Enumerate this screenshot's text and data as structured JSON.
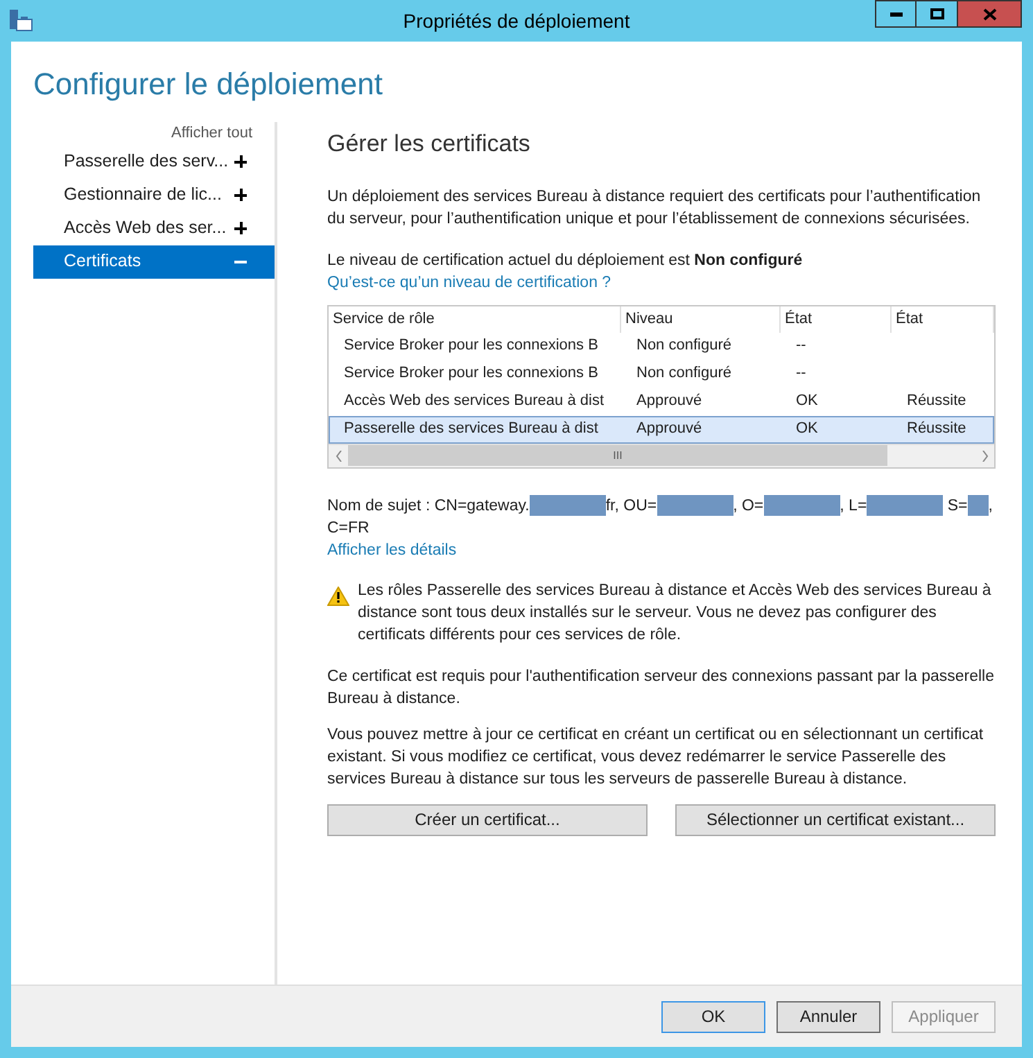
{
  "window": {
    "title": "Propriétés de déploiement"
  },
  "heading": "Configurer le déploiement",
  "sidebar": {
    "show_all": "Afficher tout",
    "items": [
      {
        "label": "Passerelle des serv...",
        "expanded": false,
        "selected": false
      },
      {
        "label": "Gestionnaire de lic...",
        "expanded": false,
        "selected": false
      },
      {
        "label": "Accès Web des ser...",
        "expanded": false,
        "selected": false
      },
      {
        "label": "Certificats",
        "expanded": true,
        "selected": true
      }
    ]
  },
  "section_title": "Gérer les certificats",
  "intro": "Un déploiement des services Bureau à distance requiert des certificats pour l’authentification du serveur, pour l’authentification unique et pour l’établissement de connexions sécurisées.",
  "level_text": "Le niveau de certification actuel du déploiement est **Non configuré**",
  "level_link": "Qu’est-ce qu’un niveau de certification ?",
  "table": {
    "columns": [
      "Service de rôle",
      "Niveau",
      "État",
      "État"
    ],
    "rows": [
      {
        "cells": [
          "Service Broker pour les connexions B",
          "Non configuré",
          "--",
          ""
        ],
        "selected": false
      },
      {
        "cells": [
          "Service Broker pour les connexions B",
          "Non configuré",
          "--",
          ""
        ],
        "selected": false
      },
      {
        "cells": [
          "Accès Web des services Bureau à dist",
          "Approuvé",
          "OK",
          "Réussite"
        ],
        "selected": false
      },
      {
        "cells": [
          "Passerelle des services Bureau à dist",
          "Approuvé",
          "OK",
          "Réussite"
        ],
        "selected": true
      }
    ],
    "scroll_grip": "III"
  },
  "subject": [
    {
      "kind": "text",
      "text": "Nom de sujet : CN=gateway."
    },
    {
      "kind": "redacted"
    },
    {
      "kind": "text",
      "text": "fr, OU="
    },
    {
      "kind": "redacted"
    },
    {
      "kind": "text",
      "text": ", O="
    },
    {
      "kind": "redacted"
    },
    {
      "kind": "text",
      "text": ", L="
    },
    {
      "kind": "redacted"
    },
    {
      "kind": "text",
      "text": " S="
    },
    {
      "kind": "redacted"
    },
    {
      "kind": "text",
      "text": ","
    },
    {
      "kind": "text",
      "text": "C=FR"
    }
  ],
  "details_link": "Afficher les détails",
  "warning": "Les rôles Passerelle des services Bureau à distance et Accès Web des services Bureau à distance sont tous deux installés sur le serveur. Vous ne devez pas configurer des certificats différents pour ces services de rôle.",
  "paragraphs": [
    "Ce certificat est requis pour l'authentification serveur des connexions passant par la passerelle Bureau à distance.",
    "Vous pouvez mettre à jour ce certificat en créant un certificat ou en sélectionnant un certificat existant. Si vous modifiez ce certificat, vous devez redémarrer le service Passerelle des services Bureau à distance sur tous les serveurs de passerelle Bureau à distance."
  ],
  "actions": [
    "Créer un certificat...",
    "Sélectionner un certificat existant..."
  ],
  "buttons": [
    {
      "label": "OK",
      "kind": "default",
      "disabled": false
    },
    {
      "label": "Annuler",
      "kind": "normal",
      "disabled": false
    },
    {
      "label": "Appliquer",
      "kind": "normal",
      "disabled": true
    }
  ]
}
